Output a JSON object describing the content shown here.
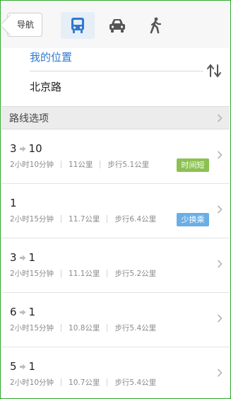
{
  "topbar": {
    "back_label": "导航",
    "tabs": [
      {
        "icon": "bus-icon",
        "active": true
      },
      {
        "icon": "car-icon",
        "active": false
      },
      {
        "icon": "walk-icon",
        "active": false
      }
    ]
  },
  "endpoints": {
    "from": "我的位置",
    "to": "北京路",
    "swap_icon": "swap-icon"
  },
  "options": {
    "label": "路线选项"
  },
  "routes": [
    {
      "a": "3",
      "b": "10",
      "duration": "2小时10分钟",
      "distance": "11公里",
      "walk": "步行5.1公里",
      "badge": "时间短",
      "badge_color": "#8cc152"
    },
    {
      "a": "1",
      "b": "",
      "duration": "2小时15分钟",
      "distance": "11.7公里",
      "walk": "步行6.4公里",
      "badge": "少换乘",
      "badge_color": "#6aaee6"
    },
    {
      "a": "3",
      "b": "1",
      "duration": "2小时15分钟",
      "distance": "11.1公里",
      "walk": "步行5.2公里",
      "badge": "",
      "badge_color": ""
    },
    {
      "a": "6",
      "b": "1",
      "duration": "2小时15分钟",
      "distance": "10.8公里",
      "walk": "步行5.4公里",
      "badge": "",
      "badge_color": ""
    },
    {
      "a": "5",
      "b": "1",
      "duration": "2小时10分钟",
      "distance": "10.7公里",
      "walk": "步行5.4公里",
      "badge": "",
      "badge_color": ""
    }
  ],
  "colors": {
    "accent": "#2f79d0",
    "frame_border": "#2ea82e"
  }
}
